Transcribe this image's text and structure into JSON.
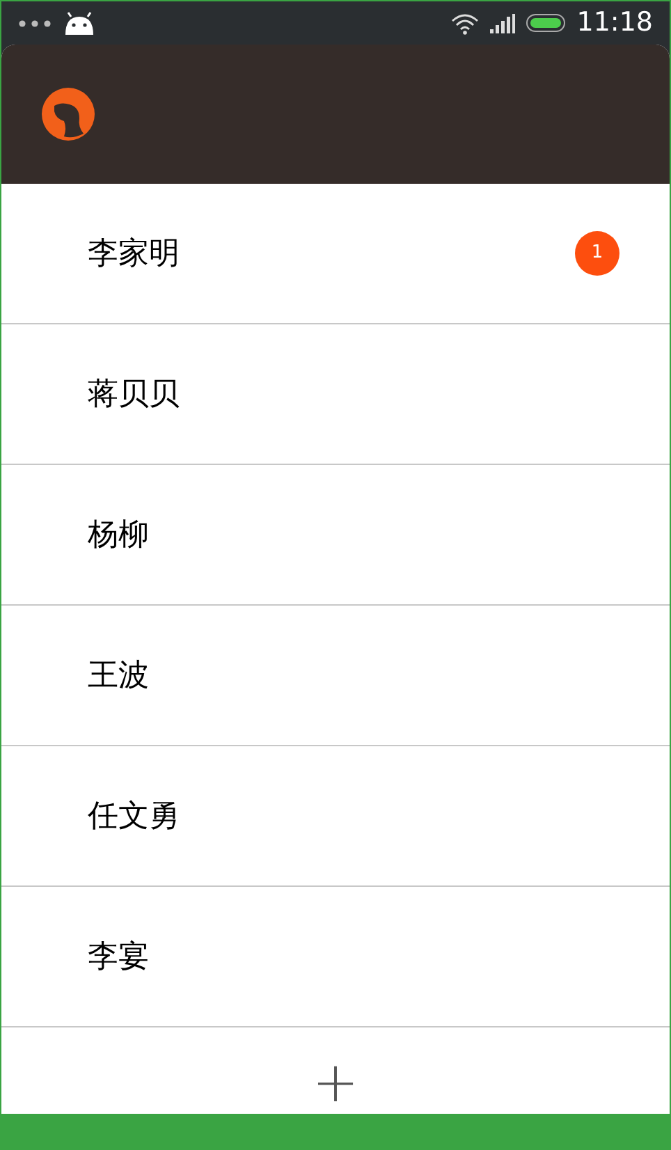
{
  "status_bar": {
    "time": "11:18"
  },
  "contacts": [
    {
      "name": "李家明",
      "badge": "1"
    },
    {
      "name": "蒋贝贝"
    },
    {
      "name": "杨柳"
    },
    {
      "name": "王波"
    },
    {
      "name": "任文勇"
    },
    {
      "name": "李宴"
    }
  ],
  "add_button": {
    "label": "+"
  }
}
